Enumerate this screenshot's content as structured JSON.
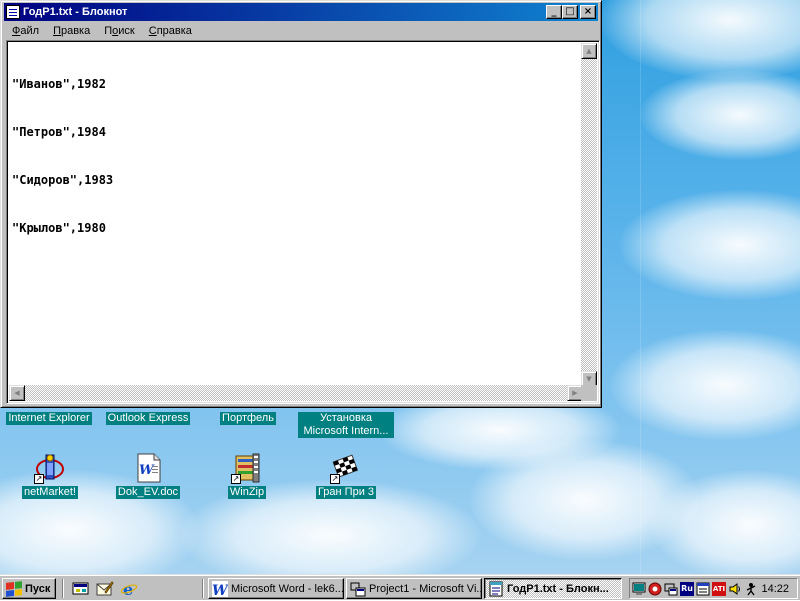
{
  "window": {
    "title": "ГодР1.txt - Блокнот",
    "menu": [
      {
        "label": "Файл",
        "accel": "Ф",
        "rest": "айл"
      },
      {
        "label": "Правка",
        "accel": "П",
        "rest": "равка"
      },
      {
        "label": "Поиск",
        "accel": "о",
        "pre": "П",
        "rest": "иск"
      },
      {
        "label": "Справка",
        "accel": "С",
        "rest": "правка"
      }
    ],
    "minimize_glyph": "_",
    "maximize_glyph": "□",
    "close_glyph": "×",
    "lines": [
      "\"Иванов\",1982",
      "\"Петров\",1984",
      "\"Сидоров\",1983",
      "\"Крылов\",1980"
    ]
  },
  "desktop_icons_row1": [
    {
      "label": "Internet Explorer"
    },
    {
      "label": "Outlook Express"
    },
    {
      "label": "Портфель"
    },
    {
      "label": "Установка",
      "label2": "Microsoft Intern..."
    }
  ],
  "desktop_icons_row2": [
    {
      "label": "netMarket!"
    },
    {
      "label": "Dok_EV.doc"
    },
    {
      "label": "WinZip"
    },
    {
      "label": "Гран При 3"
    }
  ],
  "taskbar": {
    "start_label": "Пуск",
    "tasks": [
      {
        "label": "Microsoft Word - lek6...."
      },
      {
        "label": "Project1 - Microsoft Vi..."
      },
      {
        "label": "ГодР1.txt - Блокн..."
      }
    ],
    "tray_lang": "Ru",
    "tray_ati": "ATI",
    "clock": "14:22"
  }
}
